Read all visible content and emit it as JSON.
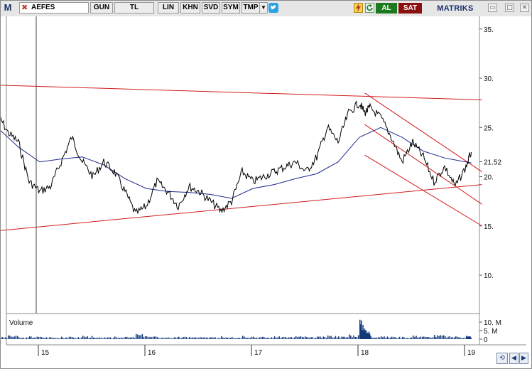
{
  "toolbar": {
    "m_label": "M",
    "symbol": "AEFES",
    "period": "GUN",
    "currency": "TL",
    "scale": "LIN",
    "buttons": [
      "KHN",
      "SVD",
      "SYM",
      "TMP"
    ],
    "al_label": "AL",
    "sat_label": "SAT",
    "brand": "MATRIKS",
    "win_min": "▭",
    "win_max": "□",
    "win_close": "✕"
  },
  "axis": {
    "y_ticks": [
      "35.",
      "30.",
      "25.",
      "21.52",
      "20.",
      "15.",
      "10."
    ],
    "x_ticks": [
      "15",
      "16",
      "17",
      "18",
      "19"
    ],
    "volume_ticks": [
      "10. M",
      "5. M",
      "0"
    ]
  },
  "volume_label": "Volume",
  "colors": {
    "price": "#000000",
    "ma": "#1b2a8c",
    "trend": "#d21a1a",
    "volume": "#123a7a",
    "grid": "#8c8c8c"
  },
  "chart_data": {
    "type": "line",
    "xlabel": "",
    "ylabel": "",
    "x_ticks": [
      "15",
      "16",
      "17",
      "18",
      "19"
    ],
    "ylim": [
      6,
      37
    ],
    "last_price": 21.52,
    "volume_max_label": "10. M",
    "series": [
      {
        "name": "",
        "kind": "price",
        "x": [
          14.6,
          14.7,
          14.8,
          14.9,
          15.0,
          15.1,
          15.2,
          15.3,
          15.4,
          15.5,
          15.6,
          15.7,
          15.8,
          15.9,
          16.0,
          16.1,
          16.2,
          16.3,
          16.4,
          16.5,
          16.6,
          16.7,
          16.8,
          16.9,
          17.0,
          17.1,
          17.2,
          17.3,
          17.4,
          17.5,
          17.6,
          17.7,
          17.8,
          17.9,
          18.0,
          18.05,
          18.1,
          18.2,
          18.3,
          18.4,
          18.5,
          18.6,
          18.7,
          18.8,
          18.9,
          19.0,
          19.05
        ],
        "y": [
          26.5,
          24.5,
          23.5,
          19.5,
          18.5,
          19.0,
          21.5,
          24.0,
          21.5,
          20.0,
          21.5,
          20.5,
          18.5,
          16.2,
          17.0,
          19.5,
          18.5,
          17.0,
          19.0,
          18.5,
          17.5,
          16.5,
          17.5,
          20.5,
          19.5,
          20.0,
          20.5,
          21.0,
          21.5,
          20.5,
          22.0,
          25.0,
          23.5,
          26.5,
          27.5,
          26.5,
          27.0,
          26.0,
          24.0,
          21.5,
          23.5,
          22.0,
          19.5,
          21.0,
          19.0,
          21.0,
          22.5
        ]
      },
      {
        "name": "",
        "kind": "moving-average",
        "x": [
          14.6,
          14.8,
          15.0,
          15.2,
          15.4,
          15.6,
          15.8,
          16.0,
          16.2,
          16.4,
          16.6,
          16.8,
          17.0,
          17.2,
          17.4,
          17.6,
          17.8,
          18.0,
          18.2,
          18.4,
          18.6,
          18.8,
          19.0,
          19.05
        ],
        "y": [
          25.0,
          23.0,
          21.5,
          21.8,
          22.0,
          21.2,
          19.8,
          18.8,
          18.5,
          18.4,
          18.2,
          17.8,
          18.8,
          19.2,
          19.8,
          20.3,
          21.5,
          24.0,
          25.0,
          24.0,
          22.6,
          21.9,
          21.5,
          21.4
        ]
      },
      {
        "name": "",
        "kind": "trendline",
        "x": [
          14.6,
          19.15
        ],
        "y": [
          29.3,
          27.8
        ]
      },
      {
        "name": "",
        "kind": "trendline",
        "x": [
          14.6,
          19.15
        ],
        "y": [
          14.5,
          19.2
        ]
      },
      {
        "name": "",
        "kind": "trendline",
        "x": [
          18.05,
          19.15
        ],
        "y": [
          28.5,
          20.5
        ]
      },
      {
        "name": "",
        "kind": "trendline",
        "x": [
          18.05,
          19.15
        ],
        "y": [
          25.3,
          17.2
        ]
      },
      {
        "name": "",
        "kind": "trendline",
        "x": [
          18.05,
          19.15
        ],
        "y": [
          22.2,
          15.0
        ]
      }
    ],
    "volume": {
      "x": [
        14.6,
        14.7,
        14.8,
        14.9,
        15.0,
        15.1,
        15.2,
        15.3,
        15.4,
        15.5,
        15.6,
        15.7,
        15.8,
        15.9,
        16.0,
        16.1,
        16.2,
        16.3,
        16.4,
        16.5,
        16.6,
        16.7,
        16.8,
        16.9,
        17.0,
        17.1,
        17.2,
        17.3,
        17.4,
        17.5,
        17.6,
        17.7,
        17.8,
        17.9,
        18.0,
        18.05,
        18.1,
        18.2,
        18.3,
        18.4,
        18.5,
        18.6,
        18.7,
        18.8,
        18.9,
        19.0,
        19.05
      ],
      "values": [
        1.2,
        2.0,
        1.0,
        1.5,
        1.2,
        1.0,
        1.3,
        1.1,
        1.8,
        0.9,
        1.0,
        1.4,
        1.2,
        2.8,
        1.5,
        1.1,
        1.0,
        1.3,
        1.2,
        1.1,
        1.0,
        1.6,
        1.2,
        1.8,
        1.3,
        1.1,
        1.5,
        1.2,
        1.6,
        1.1,
        1.4,
        2.0,
        1.5,
        2.5,
        10.5,
        5.0,
        1.8,
        1.5,
        1.3,
        1.2,
        2.0,
        1.4,
        2.3,
        1.6,
        1.5,
        1.8,
        1.6
      ]
    }
  }
}
